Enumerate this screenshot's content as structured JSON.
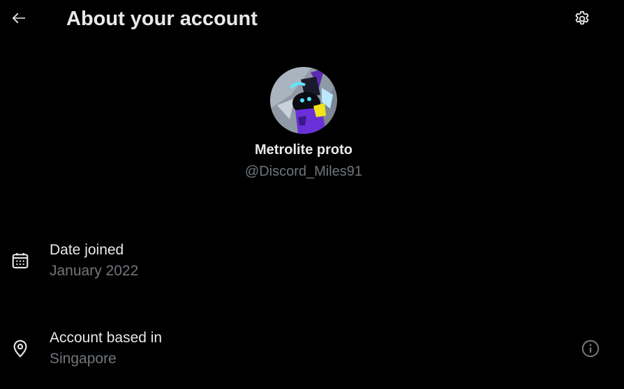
{
  "header": {
    "title": "About your account",
    "back_icon": "arrow-left-icon",
    "settings_icon": "gear-icon"
  },
  "profile": {
    "display_name": "Metrolite proto",
    "handle": "@Discord_Miles91",
    "avatar_icon": "avatar-image"
  },
  "details": [
    {
      "label": "Date joined",
      "value": "January 2022",
      "icon": "calendar-icon"
    },
    {
      "label": "Account based in",
      "value": "Singapore",
      "icon": "location-pin-icon",
      "action_icon": "info-circle-icon"
    }
  ],
  "colors": {
    "background": "#000000",
    "primary_text": "#e7e9ea",
    "secondary_text": "#71767b"
  }
}
